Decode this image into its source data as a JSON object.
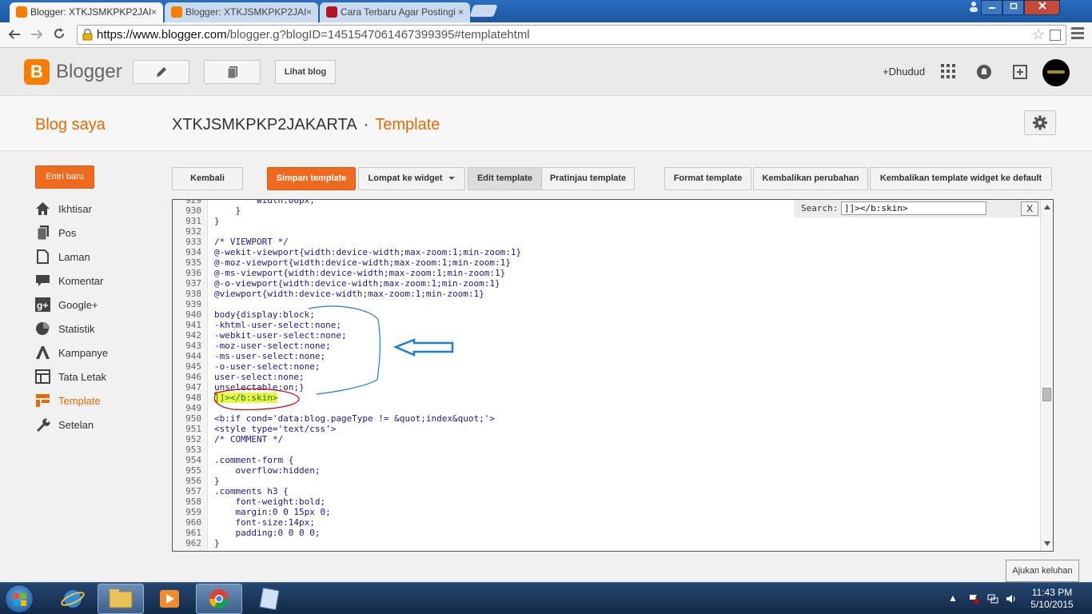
{
  "browser": {
    "tabs": [
      {
        "title": "Blogger: XTKJSMKPKP2JAI",
        "active": true
      },
      {
        "title": "Blogger: XTKJSMKPKP2JAI",
        "active": false
      },
      {
        "title": "Cara Terbaru Agar Postingi",
        "active": false
      }
    ],
    "tab_close": "×",
    "url_prefix": "https://www.blogger.com",
    "url_rest": "/blogger.g?blogID=1451547061467399395#templatehtml"
  },
  "header": {
    "brand": "Blogger",
    "view_blog_label": "Lihat blog",
    "user_name": "+Dhudud"
  },
  "titlebar": {
    "my_blog": "Blog saya",
    "blog_name": "XTKJSMKPKP2JAKARTA",
    "separator": "·",
    "page": "Template"
  },
  "sidebar": {
    "new_post": "Entri baru",
    "items": [
      {
        "label": "Ikhtisar",
        "icon": "home-icon"
      },
      {
        "label": "Pos",
        "icon": "posts-icon"
      },
      {
        "label": "Laman",
        "icon": "pages-icon"
      },
      {
        "label": "Komentar",
        "icon": "comment-icon"
      },
      {
        "label": "Google+",
        "icon": "googleplus-icon"
      },
      {
        "label": "Statistik",
        "icon": "pie-chart-icon"
      },
      {
        "label": "Kampanye",
        "icon": "campaign-icon"
      },
      {
        "label": "Tata Letak",
        "icon": "layout-icon"
      },
      {
        "label": "Template",
        "icon": "template-icon",
        "active": true
      },
      {
        "label": "Setelan",
        "icon": "wrench-icon"
      }
    ]
  },
  "toolbar": {
    "back": "Kembali",
    "save": "Simpan template",
    "jump": "Lompat ke widget",
    "edit": "Edit template",
    "preview": "Pratinjau template",
    "format": "Format template",
    "revert": "Kembalikan perubahan",
    "revert_widgets": "Kembalikan template widget ke default"
  },
  "editor": {
    "search_label": "Search:",
    "search_value": "]]></b:skin>",
    "close_label": "X",
    "lines": [
      {
        "n": "929",
        "t": "        width:80px;"
      },
      {
        "n": "930",
        "t": "    }"
      },
      {
        "n": "931",
        "t": "}"
      },
      {
        "n": "932",
        "t": ""
      },
      {
        "n": "933",
        "t": "/* VIEWPORT */"
      },
      {
        "n": "934",
        "t": "@-wekit-viewport{width:device-width;max-zoom:1;min-zoom:1}"
      },
      {
        "n": "935",
        "t": "@-moz-viewport{width:device-width;max-zoom:1;min-zoom:1}"
      },
      {
        "n": "936",
        "t": "@-ms-viewport{width:device-width;max-zoom:1;min-zoom:1}"
      },
      {
        "n": "937",
        "t": "@-o-viewport{width:device-width;max-zoom:1;min-zoom:1}"
      },
      {
        "n": "938",
        "t": "@viewport{width:device-width;max-zoom:1;min-zoom:1}"
      },
      {
        "n": "939",
        "t": ""
      },
      {
        "n": "940",
        "t": "body{display:block;"
      },
      {
        "n": "941",
        "t": "-khtml-user-select:none;"
      },
      {
        "n": "942",
        "t": "-webkit-user-select:none;"
      },
      {
        "n": "943",
        "t": "-moz-user-select:none;"
      },
      {
        "n": "944",
        "t": "-ms-user-select:none;"
      },
      {
        "n": "945",
        "t": "-o-user-select:none;"
      },
      {
        "n": "946",
        "t": "user-select:none;"
      },
      {
        "n": "947",
        "t": "unselectable:on;}"
      },
      {
        "n": "948",
        "t": "]]></b:skin>",
        "highlight": true
      },
      {
        "n": "949",
        "t": ""
      },
      {
        "n": "950",
        "t": "<b:if cond='data:blog.pageType != &quot;index&quot;'>"
      },
      {
        "n": "951",
        "t": "<style type='text/css'>"
      },
      {
        "n": "952",
        "t": "/* COMMENT */"
      },
      {
        "n": "953",
        "t": ""
      },
      {
        "n": "954",
        "t": ".comment-form {"
      },
      {
        "n": "955",
        "t": "    overflow:hidden;"
      },
      {
        "n": "956",
        "t": "}"
      },
      {
        "n": "957",
        "t": ".comments h3 {"
      },
      {
        "n": "958",
        "t": "    font-weight:bold;"
      },
      {
        "n": "959",
        "t": "    margin:0 0 15px 0;"
      },
      {
        "n": "960",
        "t": "    font-size:14px;"
      },
      {
        "n": "961",
        "t": "    padding:0 0 0 0;"
      },
      {
        "n": "962",
        "t": "}"
      }
    ]
  },
  "colors": {
    "accent": "#e66a00",
    "code": "#1a1a8c",
    "highlight": "#e9f542",
    "annotation_red": "#d40000",
    "annotation_blue": "#1b7fd1"
  },
  "taskbar": {
    "tooltip": "Ajukan keluhan",
    "time": "11:43 PM",
    "date": "5/10/2015"
  }
}
